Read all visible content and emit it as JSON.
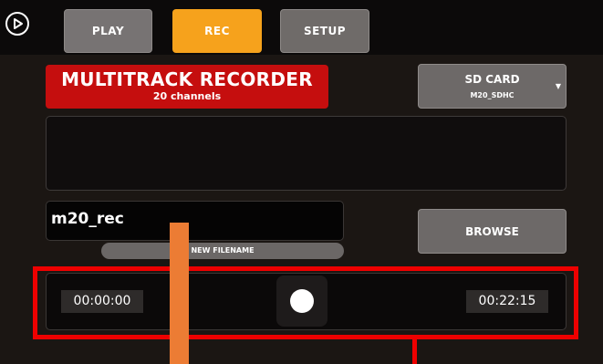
{
  "nav": {
    "play": "PLAY",
    "rec": "REC",
    "setup": "SETUP"
  },
  "recorder": {
    "title": "MULTITRACK RECORDER",
    "channels": "20 channels"
  },
  "sd_card": {
    "label": "SD CARD",
    "device": "M20_SDHC"
  },
  "filename": {
    "value": "m20_rec",
    "new_label": "NEW FILENAME"
  },
  "browse_label": "BROWSE",
  "transport": {
    "elapsed": "00:00:00",
    "remaining": "00:22:15"
  },
  "colors": {
    "rec_tab": "#f6a21c",
    "banner": "#c50e0e",
    "highlight_frame": "#ee0000",
    "marker": "#ec7c34"
  }
}
